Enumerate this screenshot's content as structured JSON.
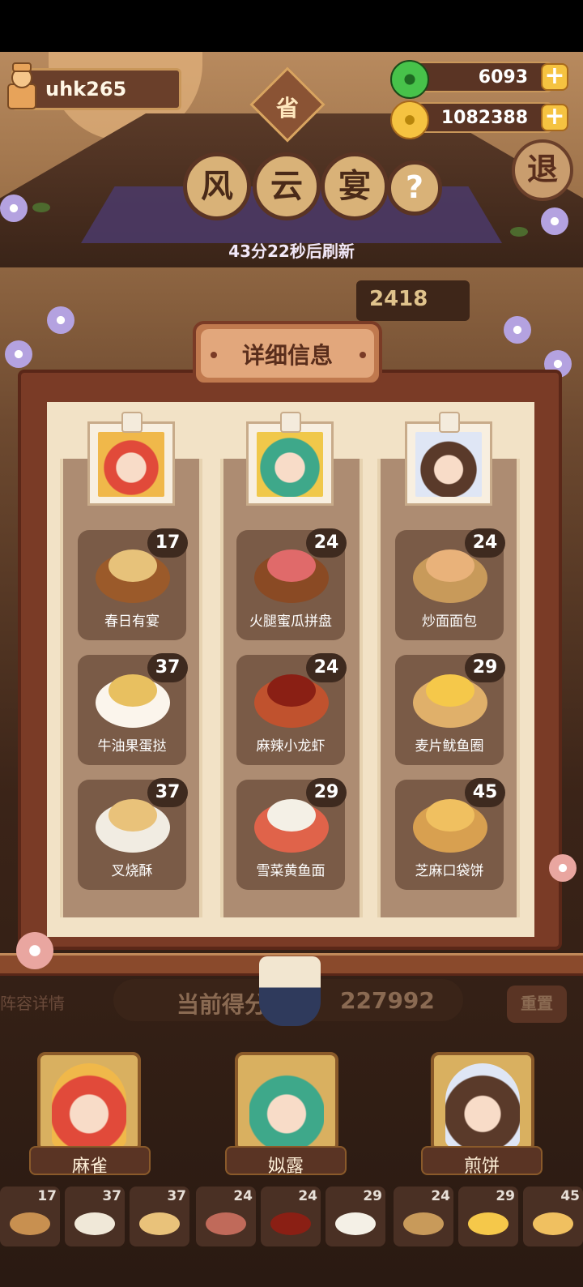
{
  "user": {
    "name": "uhk265"
  },
  "currencies": [
    {
      "icon": "jade-coin-icon",
      "value": "6093"
    },
    {
      "icon": "gold-coin-icon",
      "value": "1082388"
    }
  ],
  "exit_label": "退",
  "province_badge": "省",
  "title_chars": [
    "风",
    "云",
    "宴"
  ],
  "help_label": "?",
  "refresh_text": "43分22秒后刷新",
  "side_score": "2418",
  "panel": {
    "title": "详细信息",
    "columns": [
      {
        "character": "麻雀",
        "dishes": [
          {
            "name": "春日有宴",
            "score": "17"
          },
          {
            "name": "牛油果蛋挞",
            "score": "37"
          },
          {
            "name": "叉烧酥",
            "score": "37"
          }
        ]
      },
      {
        "character": "姒露",
        "dishes": [
          {
            "name": "火腿蜜瓜拼盘",
            "score": "24"
          },
          {
            "name": "麻辣小龙虾",
            "score": "24"
          },
          {
            "name": "雪菜黄鱼面",
            "score": "29"
          }
        ]
      },
      {
        "character": "煎饼",
        "dishes": [
          {
            "name": "炒面面包",
            "score": "24"
          },
          {
            "name": "麦片鱿鱼圈",
            "score": "29"
          },
          {
            "name": "芝麻口袋饼",
            "score": "45"
          }
        ]
      }
    ]
  },
  "lineup_link": "阵容详情",
  "current_score": {
    "label": "当前得分",
    "value": "227992"
  },
  "reset_label": "重置",
  "characters": [
    "麻雀",
    "姒露",
    "煎饼"
  ],
  "mini_dishes": [
    "17",
    "37",
    "37",
    "24",
    "24",
    "29",
    "24",
    "29",
    "45"
  ],
  "colors": {
    "accent_gold": "#f5c341",
    "panel_bg": "#f2e2c6",
    "frame_red": "#7a3b26",
    "dish_card": "#7a5b47"
  }
}
